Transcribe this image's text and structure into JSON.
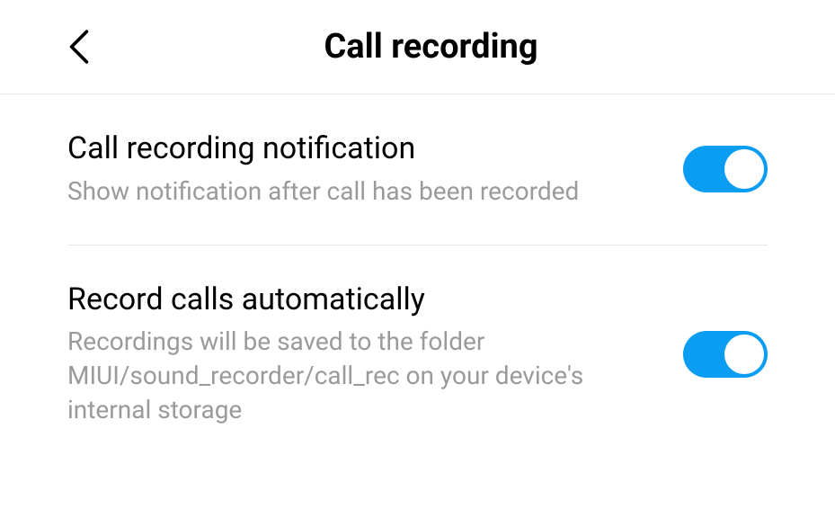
{
  "header": {
    "title": "Call recording"
  },
  "settings": [
    {
      "label": "Call recording notification",
      "description": "Show notification after call has been recorded",
      "enabled": true
    },
    {
      "label": "Record calls automatically",
      "description": "Recordings will be saved to the folder MIUI/sound_recorder/call_rec on your device's internal storage",
      "enabled": true
    }
  ],
  "colors": {
    "accent": "#0a9df1"
  }
}
